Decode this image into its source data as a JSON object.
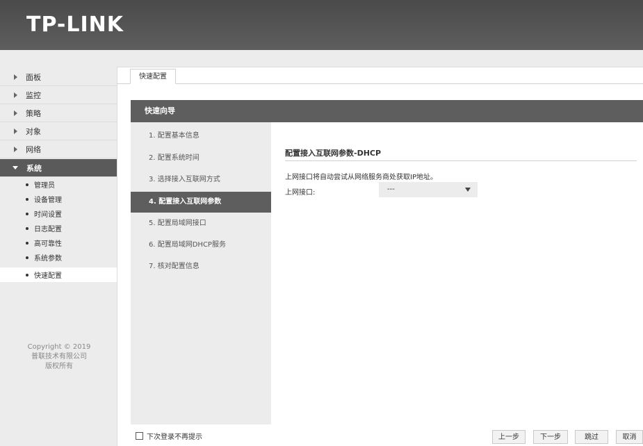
{
  "header": {
    "logo": "TP-LINK"
  },
  "sidebar": {
    "items": [
      {
        "label": "面板"
      },
      {
        "label": "监控"
      },
      {
        "label": "策略"
      },
      {
        "label": "对象"
      },
      {
        "label": "网络"
      },
      {
        "label": "系统"
      }
    ],
    "subitems": [
      {
        "label": "管理员"
      },
      {
        "label": "设备管理"
      },
      {
        "label": "时间设置"
      },
      {
        "label": "日志配置"
      },
      {
        "label": "高可靠性"
      },
      {
        "label": "系统参数"
      },
      {
        "label": "快速配置"
      }
    ],
    "copyright": [
      "Copyright © 2019",
      "普联技术有限公司",
      "版权所有"
    ]
  },
  "tab": {
    "label": "快速配置"
  },
  "wizard": {
    "title": "快速向导",
    "steps": [
      "1. 配置基本信息",
      "2. 配置系统时间",
      "3. 选择接入互联网方式",
      "4. 配置接入互联网参数",
      "5. 配置局域网接口",
      "6. 配置局域网DHCP服务",
      "7. 核对配置信息"
    ],
    "current_step": 4
  },
  "section": {
    "title": "配置接入互联网参数-DHCP",
    "description": "上网接口将自动尝试从网络服务商处获取IP地址。",
    "interface_label": "上网接口:",
    "interface_value": "---"
  },
  "footer": {
    "checkbox_label": "下次登录不再提示",
    "buttons": {
      "prev": "上一步",
      "next": "下一步",
      "skip": "跳过",
      "cancel": "取消"
    }
  }
}
